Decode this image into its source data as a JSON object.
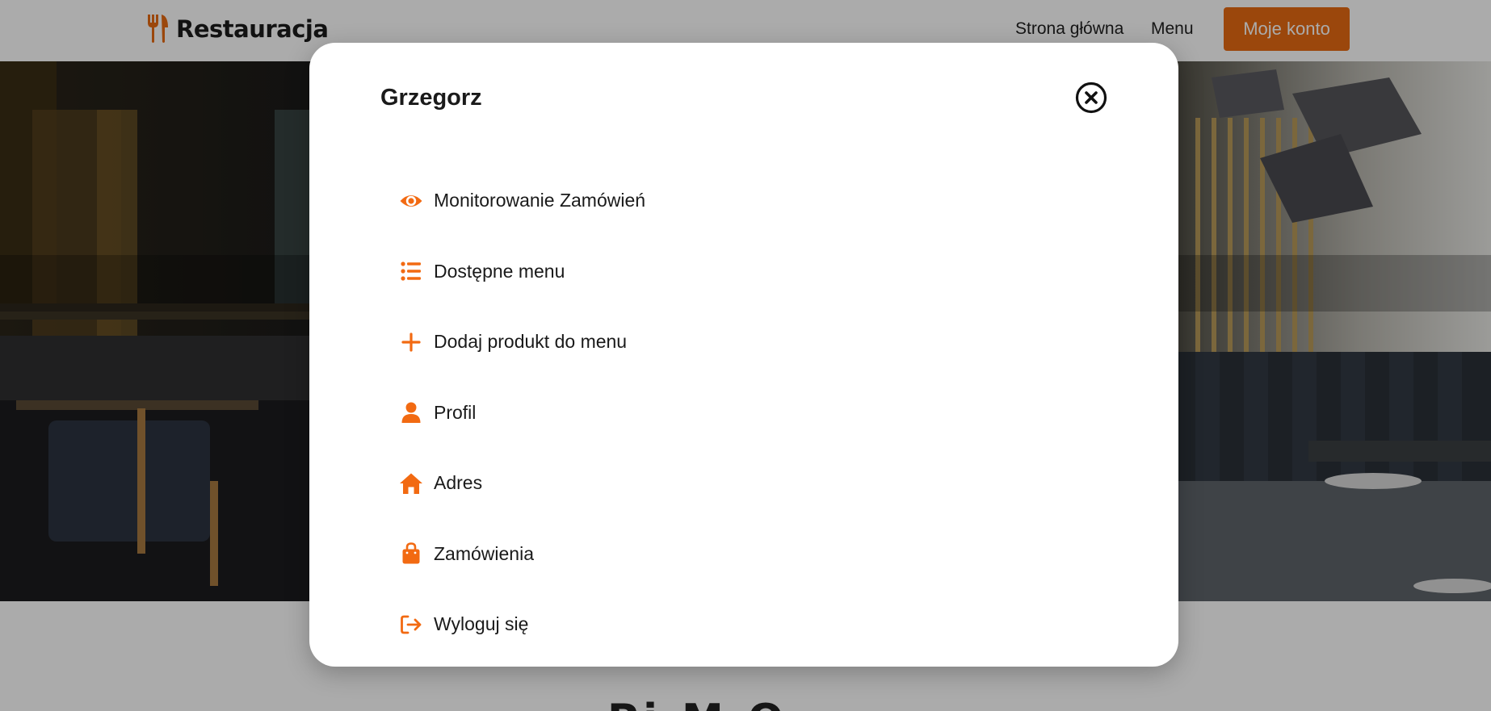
{
  "navbar": {
    "brand_name": "Restauracja",
    "brand_icon": "utensils-icon",
    "links": {
      "home": "Strona główna",
      "menu": "Menu"
    },
    "account_button": "Moje konto"
  },
  "page": {
    "section_title_partial": "Pi     M   O"
  },
  "modal": {
    "title": "Grzegorz",
    "close_icon": "close-circle-icon",
    "items": [
      {
        "label": "Monitorowanie Zamówień",
        "icon": "eye-icon"
      },
      {
        "label": "Dostępne menu",
        "icon": "list-icon"
      },
      {
        "label": "Dodaj produkt do menu",
        "icon": "plus-icon"
      },
      {
        "label": "Profil",
        "icon": "user-icon"
      },
      {
        "label": "Adres",
        "icon": "home-icon"
      },
      {
        "label": "Zamówienia",
        "icon": "shopping-bag-icon"
      },
      {
        "label": "Wyloguj się",
        "icon": "logout-icon"
      }
    ]
  },
  "colors": {
    "accent": "#e86a12",
    "icon_orange": "#f26a12",
    "overlay": "rgba(0,0,0,0.33)"
  }
}
